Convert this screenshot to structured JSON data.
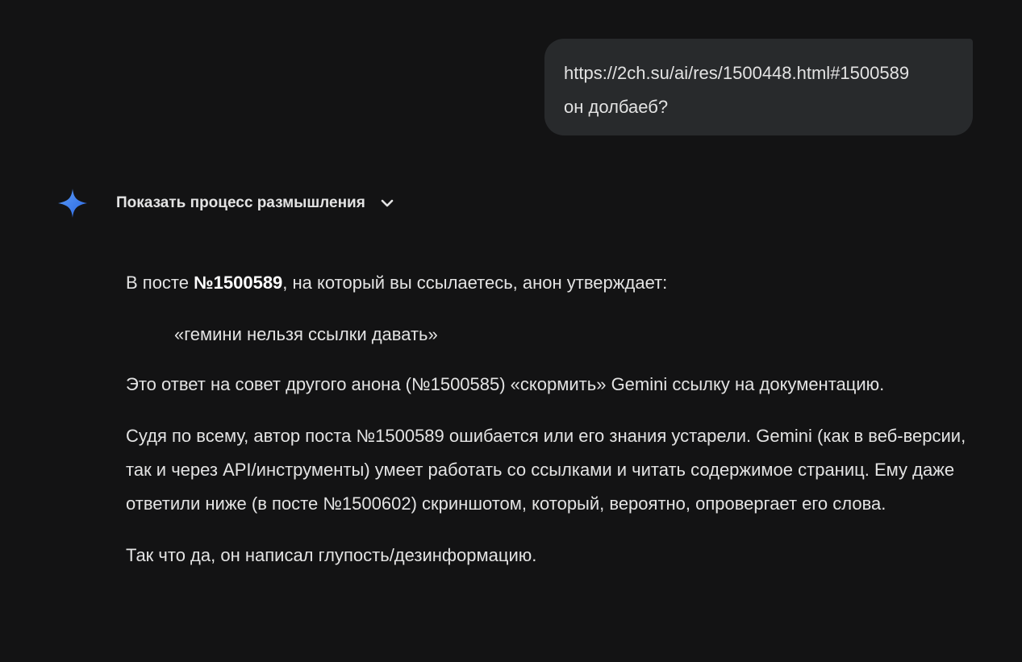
{
  "user_message": {
    "line1": "https://2ch.su/ai/res/1500448.html#1500589",
    "line2": "он долбаеб?"
  },
  "thinking": {
    "label": "Показать процесс размышления",
    "icon": "chevron-down-icon"
  },
  "assistant_icon": "gemini-sparkle-icon",
  "colors": {
    "background": "#131314",
    "bubble": "#282a2c",
    "text": "#e3e3e3",
    "sparkle_start": "#4c8df6",
    "sparkle_end": "#2d6be4"
  },
  "answer": {
    "p1_before": "В посте ",
    "p1_bold": "№1500589",
    "p1_after": ", на который вы ссылаетесь, анон утверждает:",
    "quote": "«гемини нельзя ссылки давать»",
    "p2": "Это ответ на совет другого анона (№1500585) «скормить» Gemini ссылку на документацию.",
    "p3": "Судя по всему, автор поста №1500589 ошибается или его знания устарели. Gemini (как в веб-версии, так и через API/инструменты) умеет работать со ссылками и читать содержимое страниц. Ему даже ответили ниже (в посте №1500602) скриншотом, который, вероятно, опровергает его слова.",
    "p4": "Так что да, он написал глупость/дезинформацию."
  }
}
